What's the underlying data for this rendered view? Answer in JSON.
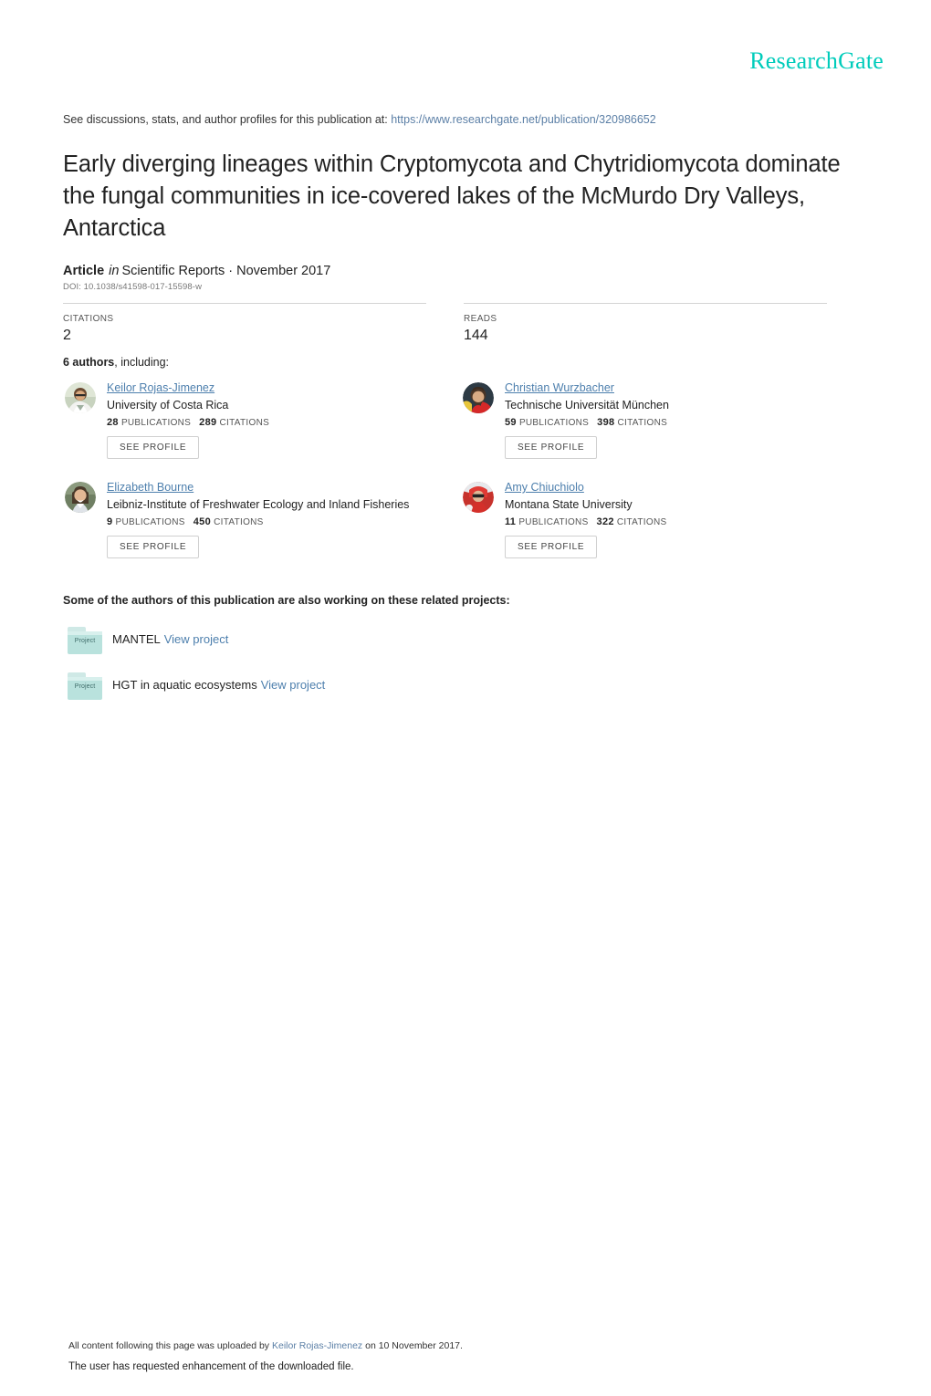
{
  "brand": {
    "logo_text": "ResearchGate",
    "accent_color": "#00ccbb",
    "link_color": "#4d7fad"
  },
  "header": {
    "discussion_prefix": "See discussions, stats, and author profiles for this publication at:",
    "publication_url": "https://www.researchgate.net/publication/320986652"
  },
  "publication": {
    "title": "Early diverging lineages within Cryptomycota and Chytridiomycota dominate the fungal communities in ice-covered lakes of the McMurdo Dry Valleys, Antarctica",
    "type_label": "Article",
    "in_label": "in",
    "venue": "Scientific Reports · November 2017",
    "doi": "DOI: 10.1038/s41598-017-15598-w"
  },
  "stats": [
    {
      "label": "CITATIONS",
      "value": "2"
    },
    {
      "label": "READS",
      "value": "144"
    }
  ],
  "authors_section": {
    "count_text": "6 authors",
    "suffix_text": ", including:",
    "see_profile_label": "SEE PROFILE",
    "publications_label": "PUBLICATIONS",
    "citations_label": "CITATIONS"
  },
  "authors": [
    {
      "name": "Keilor Rojas-Jimenez",
      "affiliation": "University of Costa Rica",
      "publications": "28",
      "citations": "289"
    },
    {
      "name": "Christian Wurzbacher",
      "affiliation": "Technische Universität München",
      "publications": "59",
      "citations": "398"
    },
    {
      "name": "Elizabeth Bourne",
      "affiliation": "Leibniz-Institute of Freshwater Ecology and Inland Fisheries",
      "publications": "9",
      "citations": "450"
    },
    {
      "name": "Amy Chiuchiolo",
      "affiliation": "Montana State University",
      "publications": "11",
      "citations": "322"
    }
  ],
  "projects_section": {
    "heading": "Some of the authors of this publication are also working on these related projects:",
    "folder_icon_text": "Project",
    "view_label": "View project"
  },
  "projects": [
    {
      "name": "MANTEL"
    },
    {
      "name": "HGT in aquatic ecosystems"
    }
  ],
  "footer": {
    "line1_prefix": "All content following this page was uploaded by",
    "uploader": "Keilor Rojas-Jimenez",
    "line1_suffix": "on 10 November 2017.",
    "line2": "The user has requested enhancement of the downloaded file."
  }
}
